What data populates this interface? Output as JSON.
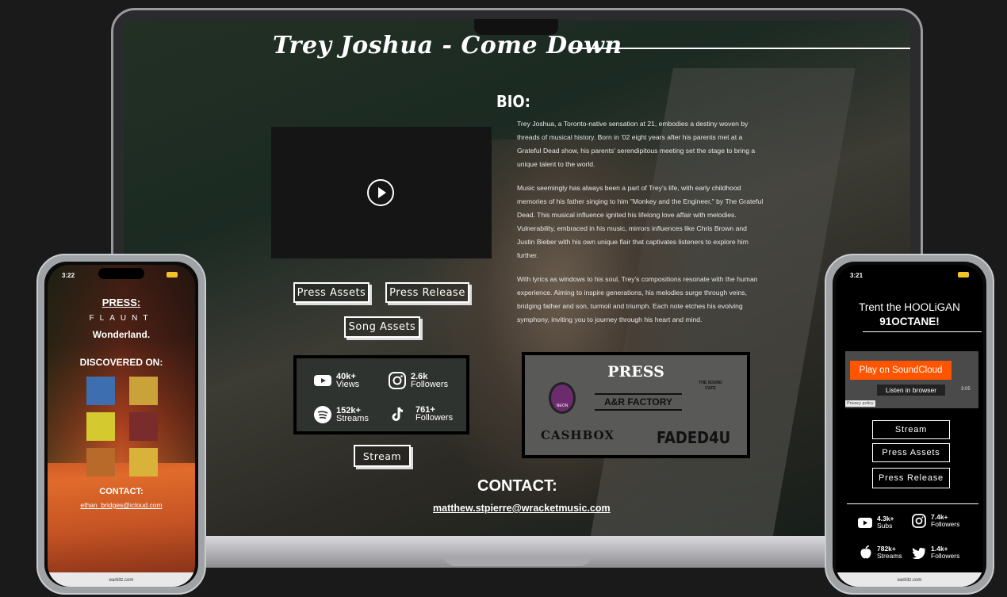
{
  "laptop": {
    "title": "Trey Joshua - Come Down",
    "buttons": [
      "Press Assets",
      "Press Release",
      "Song Assets",
      "Stream"
    ],
    "stats": [
      {
        "icon": "youtube-icon",
        "value": "40k+",
        "label": "Views"
      },
      {
        "icon": "instagram-icon",
        "value": "2.6k",
        "label": "Followers"
      },
      {
        "icon": "spotify-icon",
        "value": "152k+",
        "label": "Streams"
      },
      {
        "icon": "tiktok-icon",
        "value": "761+",
        "label": "Followers"
      }
    ],
    "press": {
      "heading": "PRESS",
      "logos": [
        "NEON",
        "A&R FACTORY",
        "THE SOUND CAFE",
        "CASHBOX",
        "FADED4U"
      ]
    },
    "bio": {
      "heading": "BIO:",
      "paragraphs": [
        "Trey Joshua, a Toronto-native sensation at 21, embodies a destiny woven by threads of musical history. Born in '02 eight years after his parents met at a Grateful Dead show, his parents' serendipitous meeting set the stage to bring a unique talent to the world.",
        "Music seemingly has always been a part of Trey's life, with early childhood memories of his father singing to him \"Monkey and the Engineer,\" by The Grateful Dead. This musical influence ignited his lifelong love affair with melodies. Vulnerability, embraced in his music, mirrors influences like Chris Brown and Justin Bieber with his own unique flair that captivates listeners to explore him further.",
        "With lyrics as windows to his soul, Trey's compositions resonate with the human experience. Aiming to inspire generations, his melodies surge through veins, bridging father and son, turmoil and triumph. Each note etches his evolving symphony, inviting you to journey through his heart and mind."
      ]
    },
    "contact": {
      "heading": "CONTACT:",
      "email": "matthew.stpierre@wracketmusic.com"
    }
  },
  "phone_left": {
    "time": "3:22",
    "press_heading": "PRESS:",
    "press_logos": [
      "FLAUNT",
      "Wonderland."
    ],
    "discovered_heading": "DISCOVERED ON:",
    "covers": [
      "#3d6fb0",
      "#c9a23a",
      "#d4c92f",
      "#7a2b2b",
      "#b86a2a",
      "#d9b23a"
    ],
    "contact_heading": "CONTACT:",
    "email": "ethan_bridges@icloud.com",
    "url": "earkitz.com"
  },
  "phone_right": {
    "time": "3:21",
    "title_line1": "Trent the HOOLiGAN",
    "title_line2": "91OCTANE!",
    "soundcloud": {
      "play": "Play on SoundCloud",
      "listen": "Listen in browser",
      "privacy": "Privacy policy",
      "duration": "3:05"
    },
    "buttons": [
      "Stream",
      "Press Assets",
      "Press Release"
    ],
    "stats": [
      {
        "icon": "youtube-icon",
        "value": "4.3k+",
        "label": "Subs"
      },
      {
        "icon": "instagram-icon",
        "value": "7.4k+",
        "label": "Followers"
      },
      {
        "icon": "apple-icon",
        "value": "782k+",
        "label": "Streams"
      },
      {
        "icon": "twitter-icon",
        "value": "1.4k+",
        "label": "Followers"
      }
    ],
    "url": "earkitz.com"
  },
  "colors": {
    "soundcloud": "#ff5500",
    "background": "#1a1a1a"
  }
}
